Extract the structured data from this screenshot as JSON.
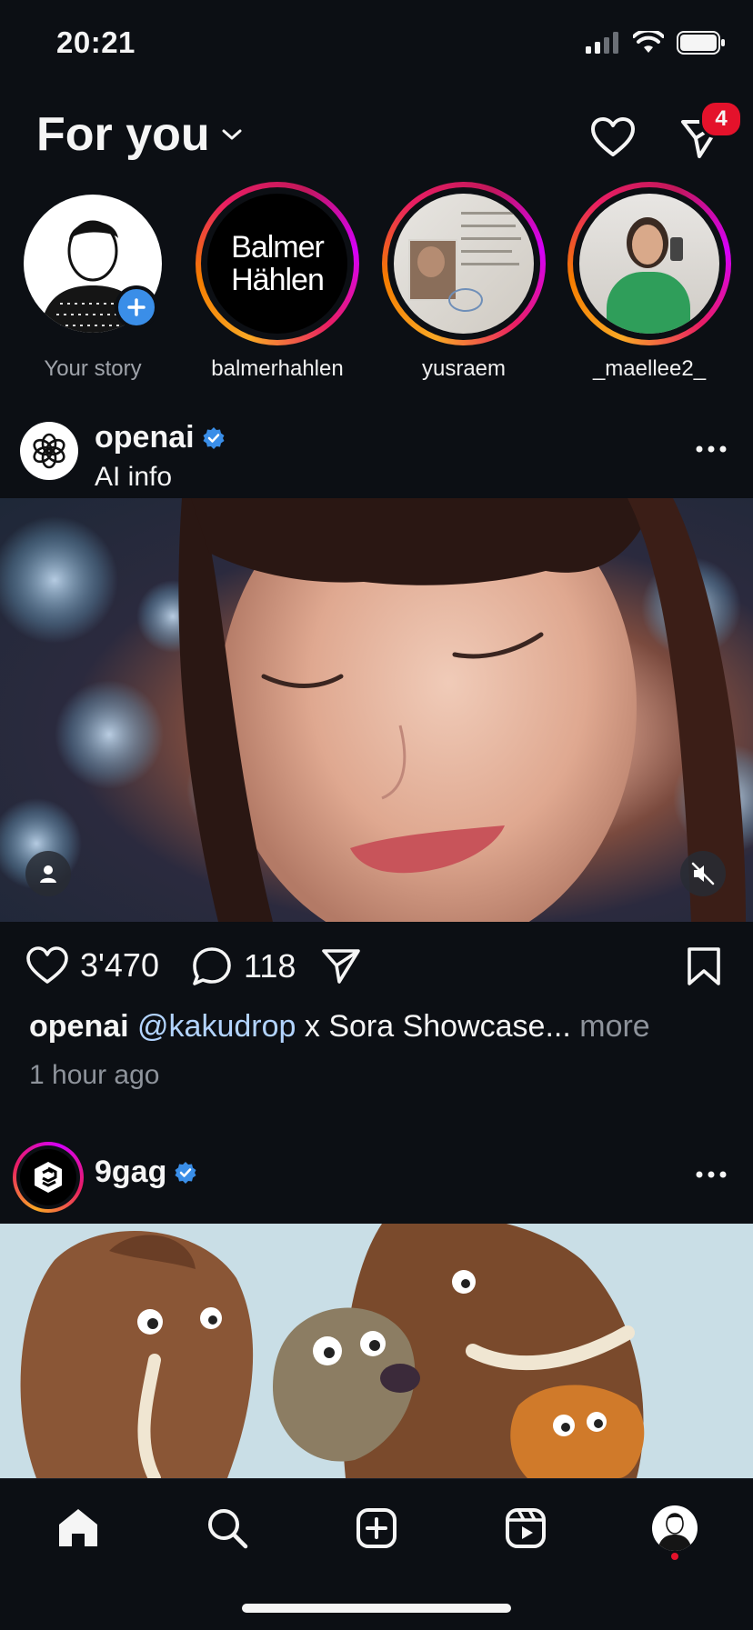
{
  "status": {
    "time": "20:21"
  },
  "header": {
    "title": "For you",
    "notifications_badge": "4"
  },
  "stories": [
    {
      "name": "Your story",
      "own": true
    },
    {
      "name": "balmerhahlen",
      "logo_text_1": "Balmer",
      "logo_text_2": "Hählen"
    },
    {
      "name": "yusraem"
    },
    {
      "name": "_maellee2_"
    }
  ],
  "post1": {
    "username": "openai",
    "verified": true,
    "subtitle": "AI info",
    "likes": "3'470",
    "comments": "118",
    "caption_user": "openai",
    "caption_mention": "@kakudrop",
    "caption_text": " x Sora Showcase...",
    "caption_more": " more",
    "time_ago": "1 hour ago"
  },
  "post2": {
    "username": "9gag",
    "verified": true
  },
  "nav": {
    "items": [
      "home-icon",
      "search-icon",
      "create-icon",
      "reels-icon",
      "profile-avatar"
    ]
  },
  "colors": {
    "background": "#0c0f14",
    "accent_blue": "#3a8ee8",
    "badge_red": "#e4122b",
    "mention": "#b3d4ff"
  }
}
